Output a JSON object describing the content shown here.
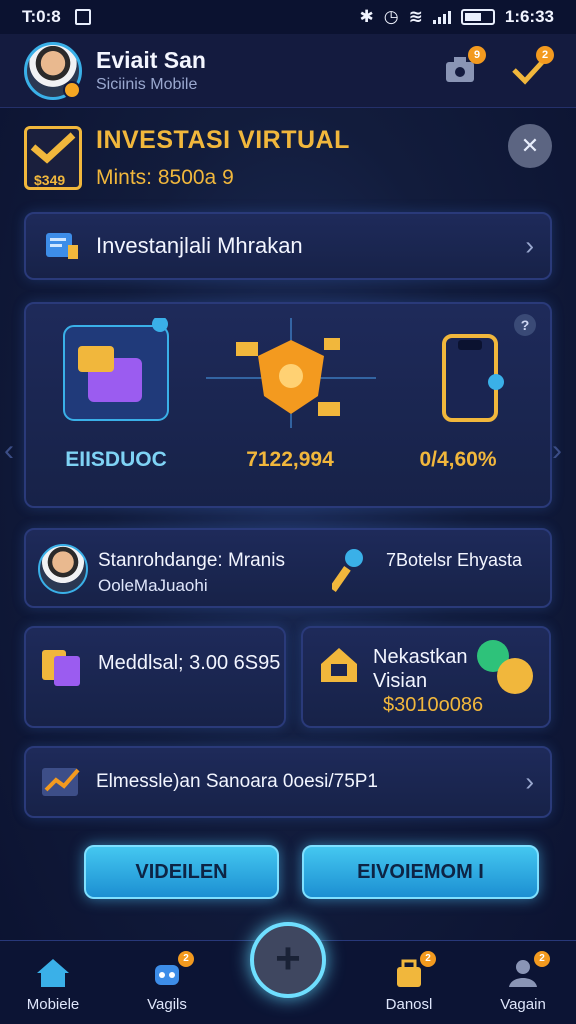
{
  "status": {
    "time": "T:0:8",
    "clock": "1:6:33"
  },
  "header": {
    "name": "Eviait San",
    "subtitle": "Siciinis Mobile",
    "notif_count": "9",
    "check_count": "2"
  },
  "invest": {
    "title": "INVESTASI VIRTUAL",
    "subtitle": "Mints: 8500a 9",
    "amount": "$349"
  },
  "row1": {
    "label": "Investanjlali Mhrakan"
  },
  "tiles": [
    {
      "caption": "EIISDUOC",
      "color": "#7fd3f5"
    },
    {
      "caption": "7122,994",
      "color": "#f1b73c"
    },
    {
      "caption": "0/4,60%",
      "color": "#f1b73c"
    }
  ],
  "person": {
    "title": "Stanrohdange: Mranis",
    "sub": "OoleMaJuaohi",
    "right": "7Botelsr Ehyasta"
  },
  "half_left": {
    "label": "Meddlsal; 3.00 6S95"
  },
  "half_right": {
    "line1": "Nekastkan",
    "line2": "Visian",
    "amount": "$3010o086"
  },
  "row5": {
    "label": "Elmessle)an Sanoara 0oesi/75P1"
  },
  "buttons": {
    "left": "VIDEILEN",
    "right": "EIVOIEMOM I"
  },
  "nav": [
    {
      "label": "Mobiele",
      "badge": ""
    },
    {
      "label": "Vagils",
      "badge": "2"
    },
    {
      "label": "Danosl",
      "badge": "2"
    },
    {
      "label": "Vagain",
      "badge": "2"
    }
  ],
  "fab": "+"
}
